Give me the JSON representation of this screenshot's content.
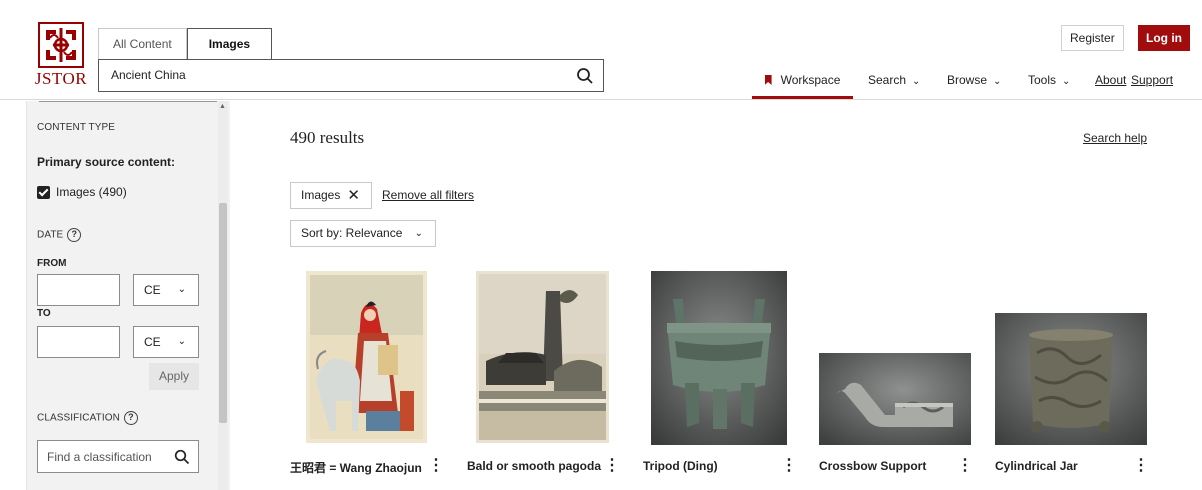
{
  "brand": {
    "logo_text": "JSTOR"
  },
  "search": {
    "scope_tabs": [
      "All Content",
      "Images"
    ],
    "query": "Ancient China"
  },
  "account": {
    "register_label": "Register",
    "login_label": "Log in"
  },
  "nav": {
    "workspace": "Workspace",
    "search": "Search",
    "browse": "Browse",
    "tools": "Tools",
    "about": "About",
    "support": "Support"
  },
  "sidebar": {
    "content_type_heading": "CONTENT TYPE",
    "primary_source_label": "Primary source content:",
    "images_filter_label": "Images (490)",
    "images_filter_checked": true,
    "date_heading": "DATE",
    "from_label": "FROM",
    "to_label": "TO",
    "from_era": "CE",
    "to_era": "CE",
    "apply_label": "Apply",
    "classification_heading": "CLASSIFICATION",
    "classification_placeholder": "Find a classification"
  },
  "results": {
    "count_text": "490 results",
    "search_help": "Search help",
    "active_filter": "Images",
    "remove_filters": "Remove all filters",
    "sort_label": "Sort by: Relevance",
    "items": [
      {
        "title": "王昭君 = Wang Zhaojun"
      },
      {
        "title": "Bald or smooth pagoda"
      },
      {
        "title": "Tripod (Ding)"
      },
      {
        "title": "Crossbow Support"
      },
      {
        "title": "Cylindrical Jar"
      }
    ]
  },
  "colors": {
    "brand_red": "#a10c0c",
    "sidebar_bg": "#f2f2f2"
  }
}
